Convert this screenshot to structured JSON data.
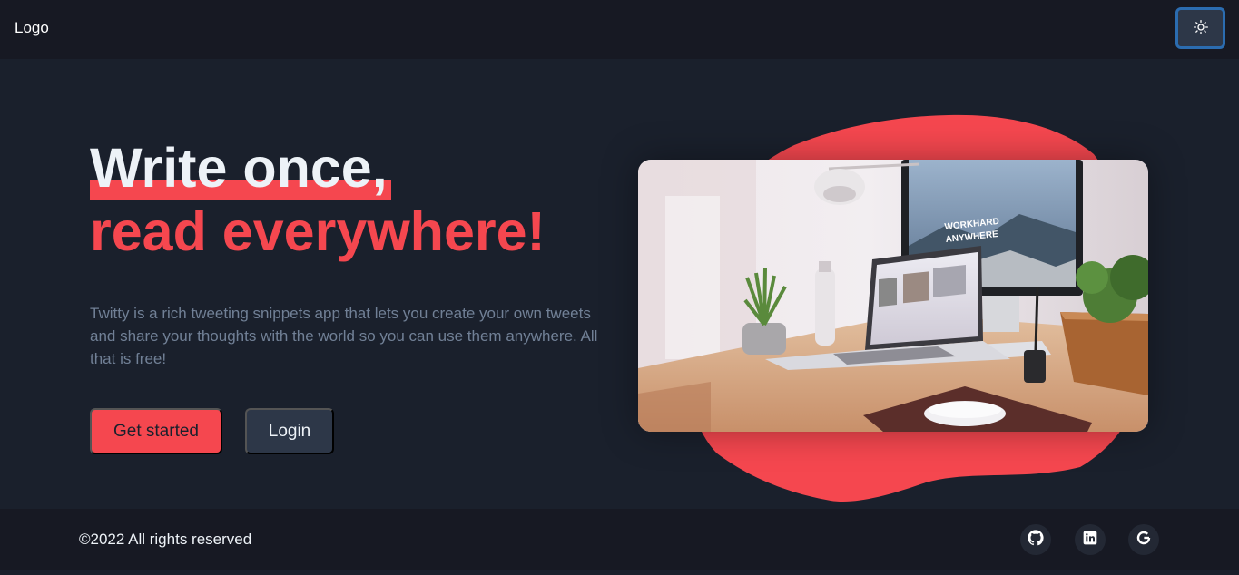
{
  "header": {
    "logo": "Logo",
    "theme_toggle_icon": "sun-icon"
  },
  "hero": {
    "title_line1": "Write once,",
    "title_line2": "read everywhere!",
    "description": "Twitty is a rich tweeting snippets app that lets you create your own tweets and share your thoughts with the world so you can use them anywhere. All that is free!",
    "primary_button": "Get started",
    "secondary_button": "Login",
    "image": {
      "monitor_text_line1": "WORKHARD",
      "monitor_text_line2": "ANYWHERE"
    }
  },
  "footer": {
    "copyright": "©2022 All rights reserved",
    "social_links": [
      "github-icon",
      "linkedin-icon",
      "google-icon"
    ]
  },
  "colors": {
    "accent": "#f5474f",
    "background": "#1a202c",
    "header_footer": "#171923",
    "muted_text": "#718096",
    "button_secondary": "#2d3748",
    "focus_ring": "#2b6cb0"
  }
}
